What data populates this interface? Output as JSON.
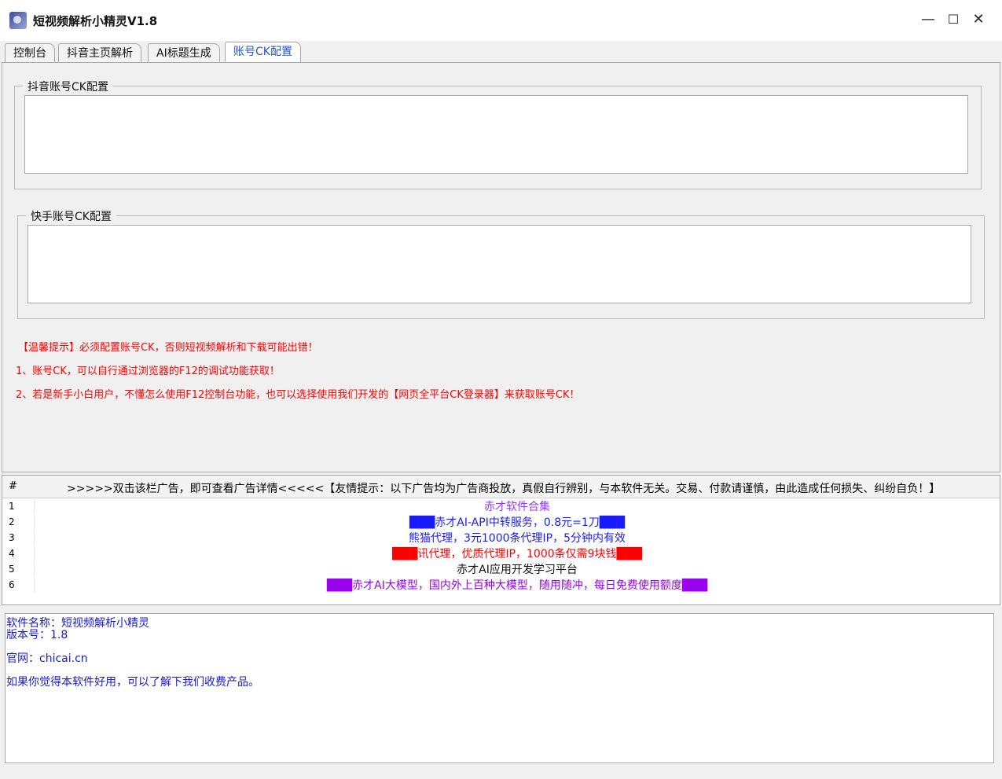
{
  "window": {
    "title": "短视频解析小精灵V1.8",
    "minimize": "—",
    "maximize": "☐",
    "close": "✕"
  },
  "tabs": [
    "控制台",
    "抖音主页解析",
    "AI标题生成",
    "账号CK配置"
  ],
  "active_tab": "账号CK配置",
  "douyin_group": {
    "legend": "抖音账号CK配置",
    "value": ""
  },
  "kuaishou_group": {
    "legend": "快手账号CK配置",
    "value": ""
  },
  "tips": [
    "【温馨提示】必须配置账号CK，否则短视频解析和下载可能出错！",
    "1、账号CK，可以自行通过浏览器的F12的调试功能获取！",
    "2、若是新手小白用户，不懂怎么使用F12控制台功能，也可以选择使用我们开发的【网页全平台CK登录器】来获取账号CK！"
  ],
  "ad_table": {
    "col_num": "#",
    "col_header": ">>>>>双击该栏广告，即可查看广告详情<<<<<【友情提示：以下广告均为广告商投放，真假自行辨别，与本软件无关。交易、付款请谨慎，由此造成任何损失、纠纷自负！】",
    "rows": [
      {
        "num": "1",
        "text": "赤才软件合集",
        "color": "#9933ff"
      },
      {
        "num": "2",
        "text": "███赤才AI-API中转服务，0.8元=1刀███",
        "color": "#1a1aff"
      },
      {
        "num": "3",
        "text": "熊猫代理，3元1000条代理IP，5分钟内有效",
        "color": "#1a1aff"
      },
      {
        "num": "4",
        "text": "███讯代理，优质代理IP，1000条仅需9块钱███",
        "color": "#ff0000"
      },
      {
        "num": "5",
        "text": "赤才AI应用开发学习平台",
        "color": "#111111"
      },
      {
        "num": "6",
        "text": "███赤才AI大模型，国内外上百种大模型，随用随冲，每日免费使用额度███",
        "color": "#9900ee"
      }
    ]
  },
  "info": {
    "name": "软件名称：短视频解析小精灵",
    "version": "版本号：1.8",
    "site": "官网：chicai.cn",
    "promo": "如果你觉得本软件好用，可以了解下我们收费产品。"
  }
}
